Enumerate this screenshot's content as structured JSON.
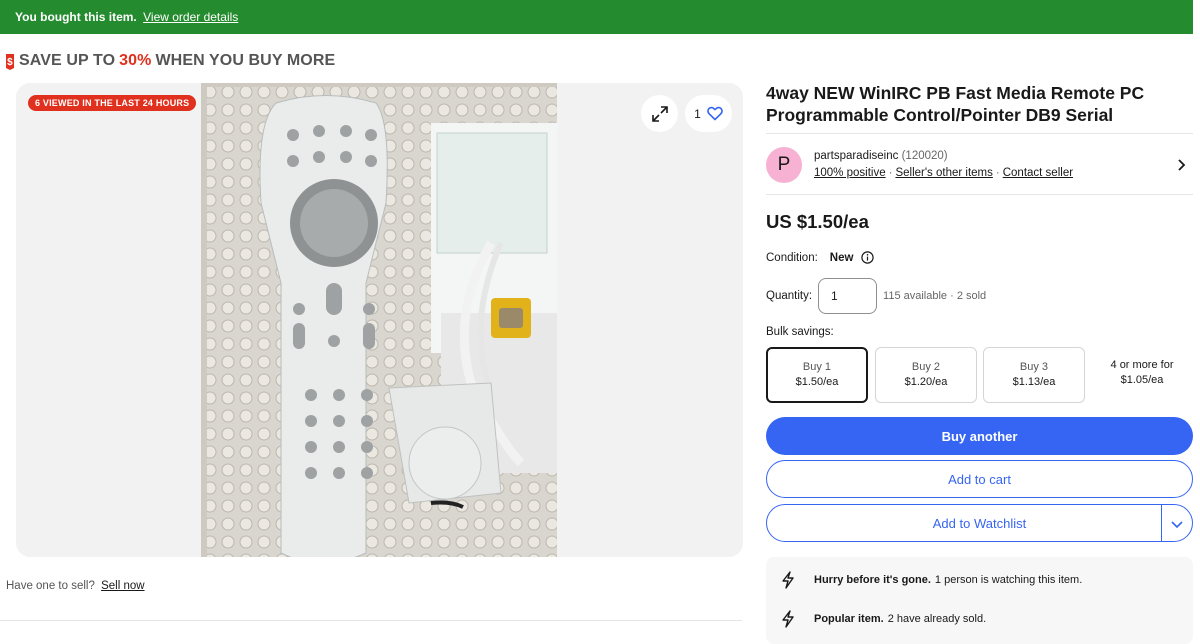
{
  "banner": {
    "message": "You bought this item.",
    "link": "View order details"
  },
  "promo": {
    "prefix": "SAVE UP TO",
    "percent": "30%",
    "suffix": "WHEN YOU BUY MORE"
  },
  "gallery": {
    "viewed_badge": "6 VIEWED IN THE LAST 24 HOURS",
    "watch_count": "1"
  },
  "sell": {
    "question": "Have one to sell?",
    "link": "Sell now"
  },
  "item": {
    "title": "4way NEW WinIRC PB Fast Media Remote PC Programmable Control/Pointer DB9 Serial"
  },
  "seller": {
    "avatar_letter": "P",
    "name": "partsparadiseinc",
    "score": "(120020)",
    "positive": "100% positive",
    "other_items": "Seller's other items",
    "contact": "Contact seller",
    "separator": "·"
  },
  "price": "US $1.50/ea",
  "condition": {
    "label": "Condition:",
    "value": "New"
  },
  "quantity": {
    "label": "Quantity:",
    "value": "1",
    "availability": "115 available · 2 sold"
  },
  "bulk": {
    "label": "Bulk savings:",
    "options": [
      {
        "label": "Buy 1",
        "price": "$1.50/ea",
        "selected": true
      },
      {
        "label": "Buy 2",
        "price": "$1.20/ea"
      },
      {
        "label": "Buy 3",
        "price": "$1.13/ea"
      }
    ],
    "more": {
      "label": "4 or more for",
      "price": "$1.05/ea"
    }
  },
  "buttons": {
    "buy": "Buy another",
    "cart": "Add to cart",
    "watch": "Add to Watchlist"
  },
  "urgency": [
    {
      "bold": "Hurry before it's gone.",
      "text": "1 person is watching this item."
    },
    {
      "bold": "Popular item.",
      "text": "2 have already sold."
    }
  ],
  "colors": {
    "banner": "#248b2e",
    "accent": "#3665f3",
    "promo_red": "#e0301e",
    "avatar": "#f7b1d2"
  },
  "icons": [
    "dollar-tag-icon",
    "expand-icon",
    "heart-icon",
    "info-icon",
    "chevron-right-icon",
    "chevron-down-icon",
    "lightning-icon"
  ]
}
